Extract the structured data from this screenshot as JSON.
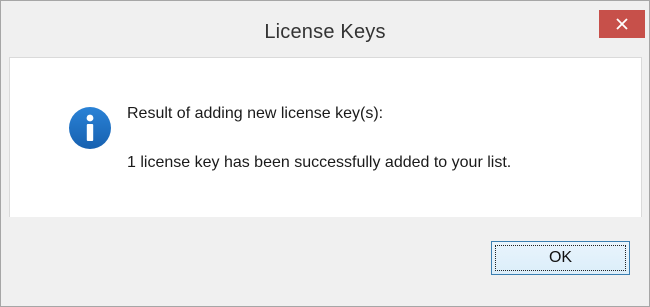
{
  "window": {
    "title": "License Keys",
    "close_icon": "close-icon",
    "close_color": "#c7504a"
  },
  "dialog": {
    "icon": "info-icon",
    "icon_color": "#1e6fc1",
    "heading": "Result of adding new license key(s):",
    "message": "1 license key has been successfully added to your list."
  },
  "buttons": {
    "ok_label": "OK"
  }
}
